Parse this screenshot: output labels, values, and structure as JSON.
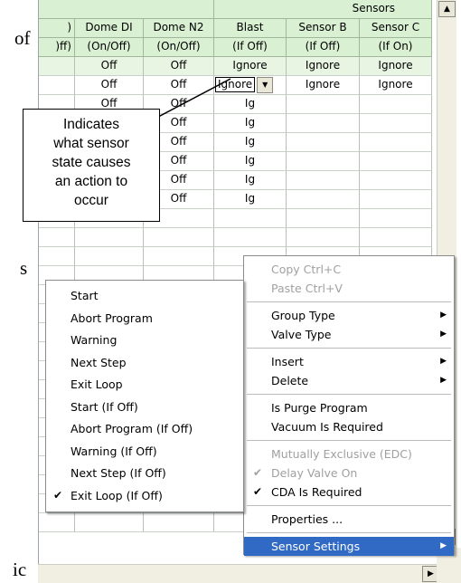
{
  "background_text": [
    "of",
    "s",
    "ic"
  ],
  "grid": {
    "group_header": "Sensors",
    "columns": [
      {
        "line1": ")",
        "line2": ")ff)"
      },
      {
        "line1": "Dome DI",
        "line2": "(On/Off)"
      },
      {
        "line1": "Dome N2",
        "line2": "(On/Off)"
      },
      {
        "line1": "Blast",
        "line2": "(If Off)"
      },
      {
        "line1": "Sensor B",
        "line2": "(If Off)"
      },
      {
        "line1": "Sensor C",
        "line2": "(If On)"
      }
    ],
    "rows": [
      [
        "Off",
        "Off",
        "Ignore",
        "Ignore",
        "Ignore"
      ],
      [
        "Off",
        "Off",
        "Ignore",
        "Ignore",
        "Ignore"
      ],
      [
        "Off",
        "Off",
        "Ig",
        "",
        ""
      ],
      [
        "Off",
        "Off",
        "Ig",
        "",
        ""
      ],
      [
        "Off",
        "Off",
        "Ig",
        "",
        ""
      ],
      [
        "Off",
        "Off",
        "Ig",
        "",
        ""
      ],
      [
        "Off",
        "Off",
        "Ig",
        "",
        ""
      ],
      [
        "Off",
        "Off",
        "Ig",
        "",
        ""
      ],
      [
        "",
        "",
        "",
        "",
        ""
      ],
      [
        "",
        "",
        "",
        "",
        ""
      ],
      [
        "",
        "",
        "",
        "",
        ""
      ],
      [
        "",
        "",
        "",
        "",
        ""
      ],
      [
        "",
        "",
        "",
        "",
        ""
      ],
      [
        "",
        "",
        "",
        "",
        ""
      ],
      [
        "",
        "",
        "",
        "",
        ""
      ],
      [
        "",
        "",
        "",
        "",
        ""
      ],
      [
        "",
        "",
        "",
        "",
        ""
      ],
      [
        "",
        "",
        "",
        "",
        ""
      ],
      [
        "",
        "",
        "",
        "",
        ""
      ],
      [
        "",
        "",
        "",
        "",
        ""
      ],
      [
        "",
        "",
        "",
        "",
        ""
      ],
      [
        "",
        "",
        "",
        "",
        ""
      ],
      [
        "",
        "",
        "",
        "",
        ""
      ],
      [
        "Off",
        "Off",
        "Ignore",
        "Ignore",
        "Ignore"
      ],
      [
        "",
        "",
        "",
        "",
        ""
      ]
    ],
    "dropdown_value": "Ignore"
  },
  "callout": {
    "lines": [
      "Indicates",
      "what sensor",
      "state causes",
      "an action to",
      "occur"
    ]
  },
  "context_menu": [
    {
      "label": "Copy  Ctrl+C",
      "disabled": true
    },
    {
      "label": "Paste Ctrl+V",
      "disabled": true
    },
    {
      "sep": true
    },
    {
      "label": "Group Type",
      "submenu": true
    },
    {
      "label": "Valve Type",
      "submenu": true
    },
    {
      "sep": true
    },
    {
      "label": "Insert",
      "submenu": true
    },
    {
      "label": "Delete",
      "submenu": true
    },
    {
      "sep": true
    },
    {
      "label": "Is Purge Program"
    },
    {
      "label": "Vacuum Is Required"
    },
    {
      "sep": true
    },
    {
      "label": "Mutually Exclusive (EDC)",
      "disabled": true
    },
    {
      "label": "Delay Valve On",
      "disabled": true,
      "checked": true
    },
    {
      "label": "CDA Is Required",
      "checked": true
    },
    {
      "sep": true
    },
    {
      "label": "Properties ..."
    },
    {
      "sep": true
    },
    {
      "label": "Sensor Settings",
      "submenu": true,
      "highlighted": true
    }
  ],
  "submenu": [
    {
      "label": "Start"
    },
    {
      "label": "Abort Program"
    },
    {
      "label": "Warning"
    },
    {
      "label": "Next Step"
    },
    {
      "label": "Exit Loop"
    },
    {
      "label": "Start (If Off)"
    },
    {
      "label": "Abort Program (If Off)"
    },
    {
      "label": "Warning (If Off)"
    },
    {
      "label": "Next Step (If Off)"
    },
    {
      "label": "Exit Loop (If Off)",
      "checked": true
    }
  ],
  "colors": {
    "header_bg": "#d9f0d3",
    "highlight": "#316ac5",
    "disabled_text": "#a0a0a0"
  },
  "icons": {
    "dropdown": "chevron-down-icon",
    "submenu_arrow": "chevron-right-icon",
    "check": "check-icon",
    "scroll_up": "scroll-up-icon",
    "scroll_down": "scroll-down-icon",
    "scroll_right": "scroll-right-icon"
  }
}
